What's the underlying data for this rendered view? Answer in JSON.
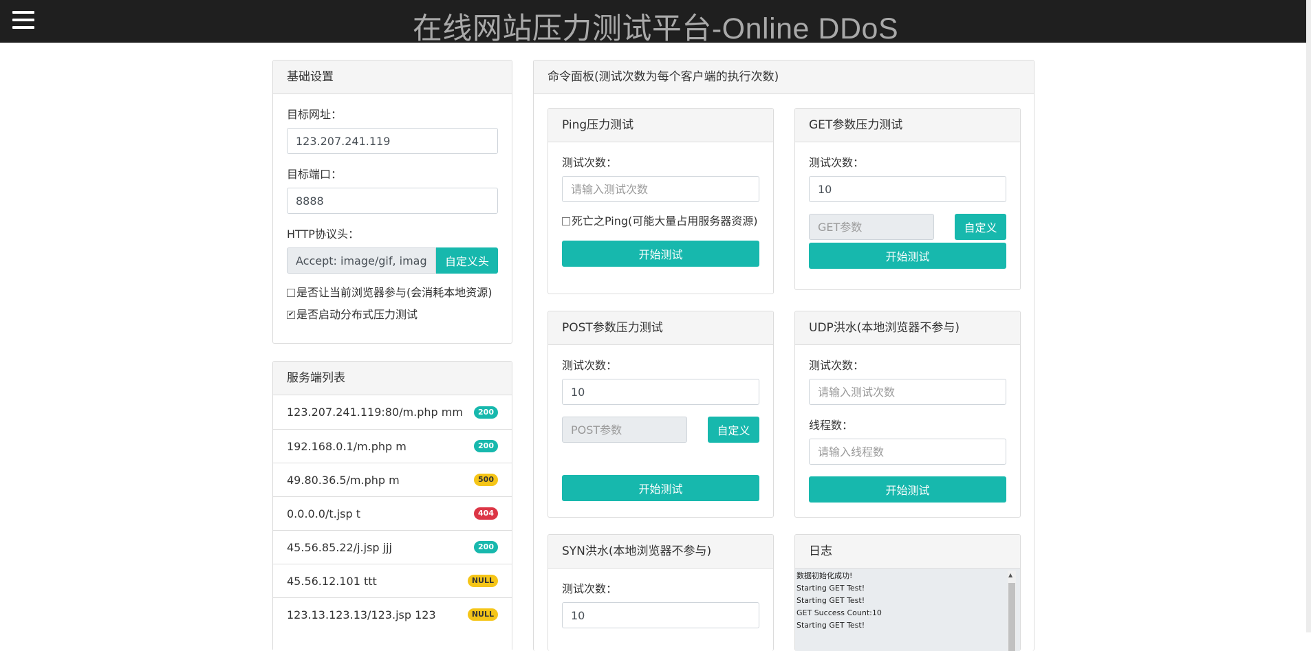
{
  "header": {
    "title": "在线网站压力测试平台-Online DDoS"
  },
  "basic": {
    "title": "基础设置",
    "target_url_label": "目标网址：",
    "target_url_value": "123.207.241.119",
    "target_port_label": "目标端口：",
    "target_port_value": "8888",
    "http_header_label": "HTTP协议头：",
    "http_header_value": "Accept: image/gif, image/x-xbitmap",
    "custom_header_button": "自定义头",
    "browser_participate": {
      "label": "是否让当前浏览器参与(会消耗本地资源)",
      "checked": false
    },
    "distributed": {
      "label": "是否启动分布式压力测试",
      "checked": true
    }
  },
  "servers": {
    "title": "服务端列表",
    "items": [
      {
        "text": "123.207.241.119:80/m.php  mm",
        "status": "200"
      },
      {
        "text": "192.168.0.1/m.php  m",
        "status": "200"
      },
      {
        "text": "49.80.36.5/m.php  m",
        "status": "500"
      },
      {
        "text": "0.0.0.0/t.jsp  t",
        "status": "404"
      },
      {
        "text": "45.56.85.22/j.jsp  jjj",
        "status": "200"
      },
      {
        "text": "45.56.12.101  ttt",
        "status": "NULL"
      },
      {
        "text": "123.13.123.13/123.jsp  123",
        "status": "NULL"
      }
    ]
  },
  "command": {
    "title": "命令面板(测试次数为每个客户端的执行次数)",
    "ping": {
      "title": "Ping压力测试",
      "count_label": "测试次数：",
      "count_placeholder": "请输入测试次数",
      "death_ping_label": "死亡之Ping(可能大量占用服务器资源)",
      "death_ping_checked": false,
      "start_button": "开始测试"
    },
    "get": {
      "title": "GET参数压力测试",
      "count_label": "测试次数：",
      "count_value": "10",
      "param_placeholder": "GET参数",
      "custom_button": "自定义",
      "start_button": "开始测试"
    },
    "post": {
      "title": "POST参数压力测试",
      "count_label": "测试次数：",
      "count_value": "10",
      "param_placeholder": "POST参数",
      "custom_button": "自定义",
      "start_button": "开始测试"
    },
    "udp": {
      "title": "UDP洪水(本地浏览器不参与)",
      "count_label": "测试次数：",
      "count_placeholder": "请输入测试次数",
      "thread_label": "线程数：",
      "thread_placeholder": "请输入线程数",
      "start_button": "开始测试"
    },
    "syn": {
      "title": "SYN洪水(本地浏览器不参与)",
      "count_label": "测试次数：",
      "count_value": "10"
    },
    "log": {
      "title": "日志",
      "lines": [
        "数据初始化成功!",
        "Starting GET Test!",
        "Starting GET Test!",
        "GET Success Count:10",
        "Starting GET Test!"
      ]
    }
  }
}
